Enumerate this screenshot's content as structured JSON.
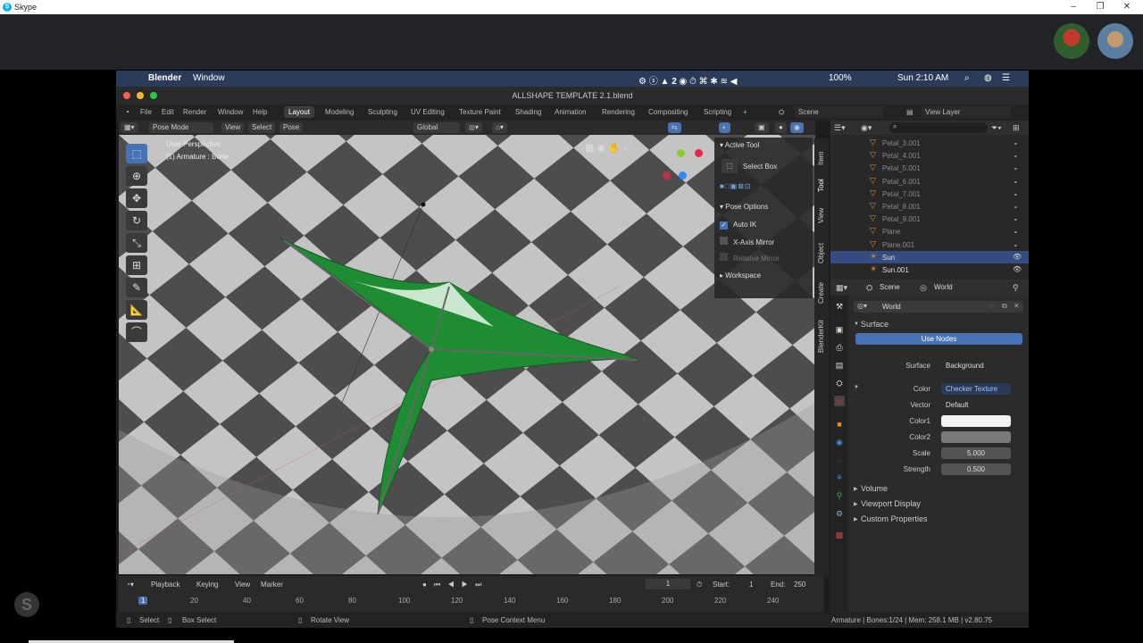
{
  "skype": {
    "title": "Skype",
    "logo": "S"
  },
  "mac_menubar": {
    "app": "Blender",
    "menu": "Window",
    "battery": "100%",
    "clock": "Sun 2:10 AM",
    "badge": "2"
  },
  "blender": {
    "file_title": "ALLSHAPE TEMPLATE 2.1.blend",
    "menus": [
      "File",
      "Edit",
      "Render",
      "Window",
      "Help"
    ],
    "workspaces": [
      "Layout",
      "Modeling",
      "Sculpting",
      "UV Editing",
      "Texture Paint",
      "Shading",
      "Animation",
      "Rendering",
      "Compositing",
      "Scripting"
    ],
    "scene": "Scene",
    "view_layer": "View Layer",
    "viewport_header": {
      "mode": "Pose Mode",
      "view": "View",
      "select": "Select",
      "pose": "Pose",
      "orientation": "Global"
    },
    "viewport_overlay": {
      "line1": "User Perspective",
      "line2": "(1) Armature : Bone"
    },
    "npanel": {
      "active_tool": "Active Tool",
      "select_box": "Select Box",
      "pose_options": "Pose Options",
      "auto_ik": "Auto IK",
      "x_axis_mirror": "X-Axis Mirror",
      "relative_mirror": "Relative Mirror",
      "workspace": "Workspace"
    },
    "side_tabs": [
      "Item",
      "Tool",
      "View",
      "Object",
      "Create",
      "BlenderKit"
    ],
    "timeline": {
      "playback": "Playback",
      "keying": "Keying",
      "view": "View",
      "marker": "Marker",
      "current_frame": "1",
      "start_label": "Start:",
      "start": "1",
      "end_label": "End:",
      "end": "250",
      "ruler": [
        "1",
        "20",
        "40",
        "60",
        "80",
        "100",
        "120",
        "140",
        "160",
        "180",
        "200",
        "220",
        "240"
      ]
    },
    "statusbar": {
      "select": "Select",
      "box_select": "Box Select",
      "rotate_view": "Rotate View",
      "pose_context": "Pose Context Menu",
      "stats": "Armature | Bones:1/24 | Mem: 258.1 MB | v2.80.75"
    },
    "outliner": [
      {
        "name": "Petal_3.001",
        "sel": false,
        "bright": false
      },
      {
        "name": "Petal_4.001",
        "sel": false,
        "bright": false
      },
      {
        "name": "Petal_5.001",
        "sel": false,
        "bright": false
      },
      {
        "name": "Petal_6.001",
        "sel": false,
        "bright": false
      },
      {
        "name": "Petal_7.001",
        "sel": false,
        "bright": false
      },
      {
        "name": "Petal_8.001",
        "sel": false,
        "bright": false
      },
      {
        "name": "Petal_9.001",
        "sel": false,
        "bright": false
      },
      {
        "name": "Plane",
        "sel": false,
        "bright": false
      },
      {
        "name": "Plane.001",
        "sel": false,
        "bright": false
      },
      {
        "name": "Sun",
        "sel": true,
        "bright": true
      },
      {
        "name": "Sun.001",
        "sel": false,
        "bright": true
      }
    ],
    "properties": {
      "scene": "Scene",
      "world_tab": "World",
      "world_name": "World",
      "surface_section": "Surface",
      "use_nodes": "Use Nodes",
      "fields": [
        {
          "label": "Surface",
          "value": "Background"
        },
        {
          "label": "Color",
          "value": "Checker Texture"
        },
        {
          "label": "Vector",
          "value": "Default"
        },
        {
          "label": "Color1",
          "value": ""
        },
        {
          "label": "Color2",
          "value": ""
        },
        {
          "label": "Scale",
          "value": "5.000"
        },
        {
          "label": "Strength",
          "value": "0.500"
        }
      ],
      "sections": [
        "Volume",
        "Viewport Display",
        "Custom Properties"
      ]
    }
  }
}
